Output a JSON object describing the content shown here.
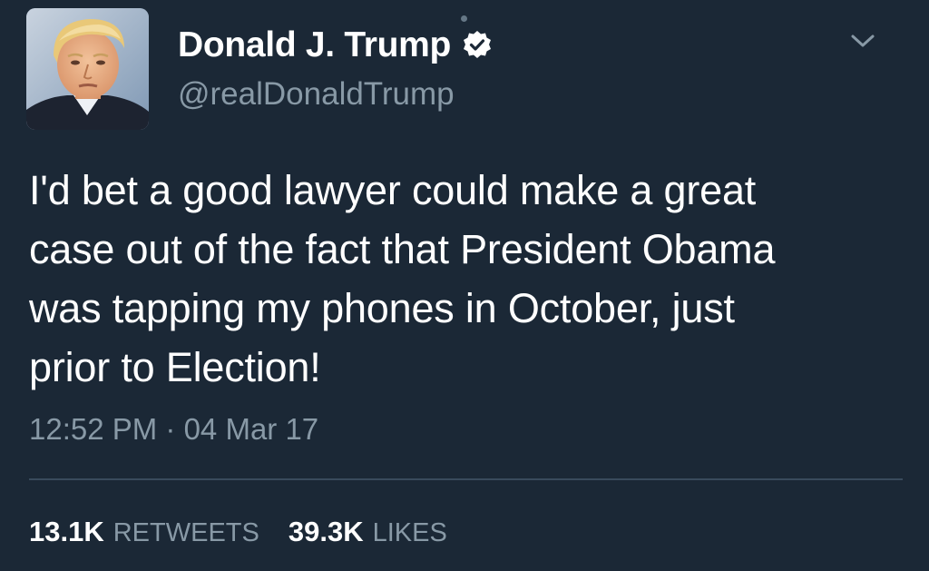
{
  "author": {
    "display_name": "Donald J. Trump",
    "handle": "@realDonaldTrump",
    "verified": true,
    "avatar_icon": "profile-photo"
  },
  "tweet": {
    "text_lines": [
      "I'd bet a good lawyer could make a great",
      "case out of the fact that President Obama",
      "was tapping my phones in October, just",
      "prior to Election!"
    ],
    "timestamp": "12:52 PM · 04 Mar 17"
  },
  "stats": {
    "retweets_count": "13.1K",
    "retweets_label": "RETWEETS",
    "likes_count": "39.3K",
    "likes_label": "LIKES"
  },
  "icons": {
    "verified": "verified-badge-icon",
    "menu": "chevron-down-icon"
  },
  "colors": {
    "background": "#1b2836",
    "primary_text": "#ffffff",
    "secondary_text": "#8899a6",
    "divider": "#394a5c"
  }
}
